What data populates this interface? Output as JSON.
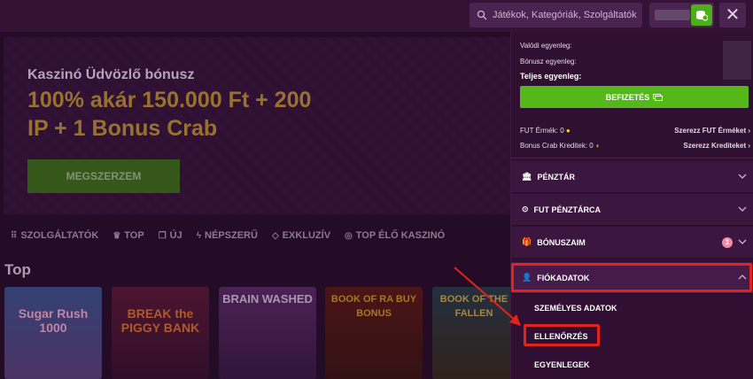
{
  "header": {
    "search_placeholder": "Játékok, Kategóriák, Szolgáltatók",
    "close_label": "✕"
  },
  "banner": {
    "subtitle": "Kaszinó Üdvözlő bónusz",
    "headline": "100% akár 150.000 Ft + 200 IP + 1 Bonus Crab",
    "cta": "MEGSZERZEM"
  },
  "categories": [
    "SZOLGÁLTATÓK",
    "TOP",
    "ÚJ",
    "NÉPSZERŰ",
    "EXKLUZÍV",
    "TOP ÉLŐ KASZINÓ"
  ],
  "section_title": "Top",
  "games": [
    "Sugar Rush 1000",
    "BREAK the PIGGY BANK",
    "BRAIN WASHED",
    "BOOK OF RA BUY BONUS",
    "BOOK OF THE FALLEN"
  ],
  "account": {
    "real_balance_label": "Valódi egyenleg:",
    "bonus_balance_label": "Bónusz egyenleg:",
    "total_balance_label": "Teljes egyenleg:",
    "deposit_button": "BEFIZETÉS",
    "fut_coins_label": "FUT Érmék: 0",
    "fut_coins_link": "Szerezz FUT Érméket",
    "bonus_crab_label": "Bonus Crab Kreditek: 0",
    "bonus_crab_link": "Szerezz Krediteket",
    "menu": [
      {
        "label": "PÉNZTÁR"
      },
      {
        "label": "FUT PÉNZTÁRCA"
      },
      {
        "label": "BÓNUSZAIM",
        "badge": "1"
      },
      {
        "label": "FIÓKADATOK"
      }
    ],
    "submenu": [
      "SZEMÉLYES ADATOK",
      "ELLENŐRZÉS",
      "EGYENLEGEK"
    ]
  },
  "colors": {
    "accent_green": "#55b81a",
    "highlight_red": "#e2231a",
    "panel_bg": "#2f1031"
  }
}
